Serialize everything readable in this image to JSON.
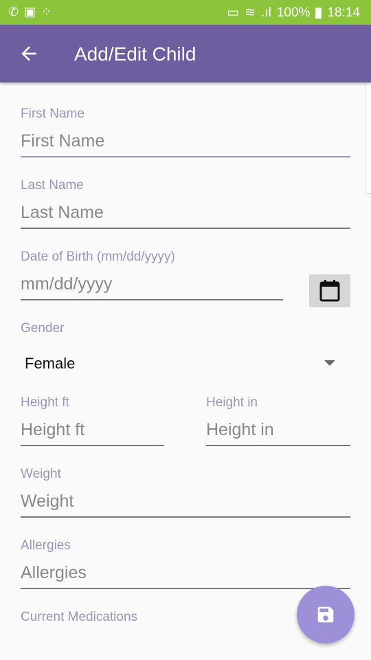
{
  "status_bar": {
    "battery": "100%",
    "time": "18:14",
    "icons": [
      "whatsapp-icon",
      "activity-icon",
      "apps-icon",
      "cast-icon",
      "wifi-icon",
      "signal-icon",
      "battery-icon"
    ]
  },
  "toolbar": {
    "title": "Add/Edit Child",
    "back_icon": "arrow-left-icon"
  },
  "form": {
    "first_name": {
      "label": "First Name",
      "placeholder": "First Name",
      "value": ""
    },
    "last_name": {
      "label": "Last Name",
      "placeholder": "Last Name",
      "value": ""
    },
    "dob": {
      "label": "Date of Birth (mm/dd/yyyy)",
      "placeholder": "mm/dd/yyyy",
      "value": ""
    },
    "gender": {
      "label": "Gender",
      "value": "Female"
    },
    "height_ft": {
      "label": "Height ft",
      "placeholder": "Height ft",
      "value": ""
    },
    "height_in": {
      "label": "Height in",
      "placeholder": "Height in",
      "value": ""
    },
    "weight": {
      "label": "Weight",
      "placeholder": "Weight",
      "value": ""
    },
    "allergies": {
      "label": "Allergies",
      "placeholder": "Allergies",
      "value": ""
    },
    "medications": {
      "label": "Current Medications"
    }
  },
  "fab": {
    "icon": "save-icon"
  },
  "colors": {
    "status_bar": "#8cc43c",
    "toolbar": "#6e5ea0",
    "fab": "#9d8fd8",
    "label": "#9b95bd"
  }
}
